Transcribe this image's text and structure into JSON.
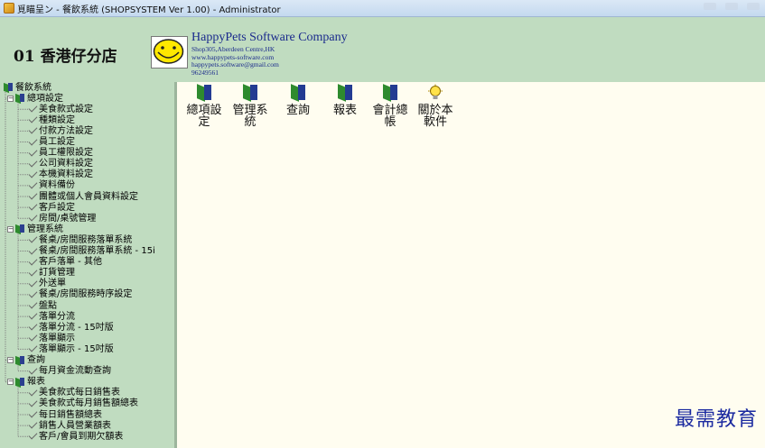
{
  "window": {
    "title": "覓瞄呈ン - 餐飲系統 (SHOPSYSTEM Ver 1.00) - Administrator"
  },
  "header": {
    "store_name": "01 香港仔分店",
    "company_name": "HappyPets Software Company",
    "address": "Shop305,Aberdeen Centre,HK",
    "website": "www.happypets-software.com",
    "email": "happypets.software@gmail.com",
    "phone": "96249561"
  },
  "tree": {
    "root": "餐飲系統",
    "groups": [
      {
        "label": "總項設定",
        "items": [
          "美食款式設定",
          "種類設定",
          "付款方法設定",
          "員工設定",
          "員工權限設定",
          "公司資料設定",
          "本機資料設定",
          "資料備份",
          "團體或個人會員資料設定",
          "客戶設定",
          "房間/桌號管理"
        ]
      },
      {
        "label": "管理系統",
        "items": [
          "餐桌/房間服務落單系統",
          "餐桌/房間服務落單系統 - 15i",
          "客戶落單 - 其他",
          "訂貨管理",
          "外送單",
          "餐桌/房間服務時序設定",
          "盤點",
          "落單分流",
          "落單分流 - 15吋版",
          "落單顯示",
          "落單顯示 - 15吋版"
        ]
      },
      {
        "label": "查詢",
        "items": [
          "每月資金流動查詢"
        ]
      },
      {
        "label": "報表",
        "items": [
          "美食款式每日銷售表",
          "美食款式每月銷售額總表",
          "每日銷售額總表",
          "銷售人員營業額表",
          "客戶/會員到期欠額表"
        ]
      }
    ]
  },
  "toolbar": {
    "items": [
      {
        "label": "總項設\n定",
        "icon": "folder-icon"
      },
      {
        "label": "管理系\n統",
        "icon": "folder-icon"
      },
      {
        "label": "查詢",
        "icon": "folder-icon"
      },
      {
        "label": "報表",
        "icon": "folder-icon"
      },
      {
        "label": "會計總\n帳",
        "icon": "folder-icon"
      },
      {
        "label": "關於本\n軟件",
        "icon": "lightbulb-icon"
      }
    ]
  },
  "watermark": "最需教育",
  "colors": {
    "panel_green": "#c0dcc0",
    "main_bg": "#fffdf0",
    "company_text": "#1a2a8c",
    "watermark": "#1b2aa0"
  }
}
